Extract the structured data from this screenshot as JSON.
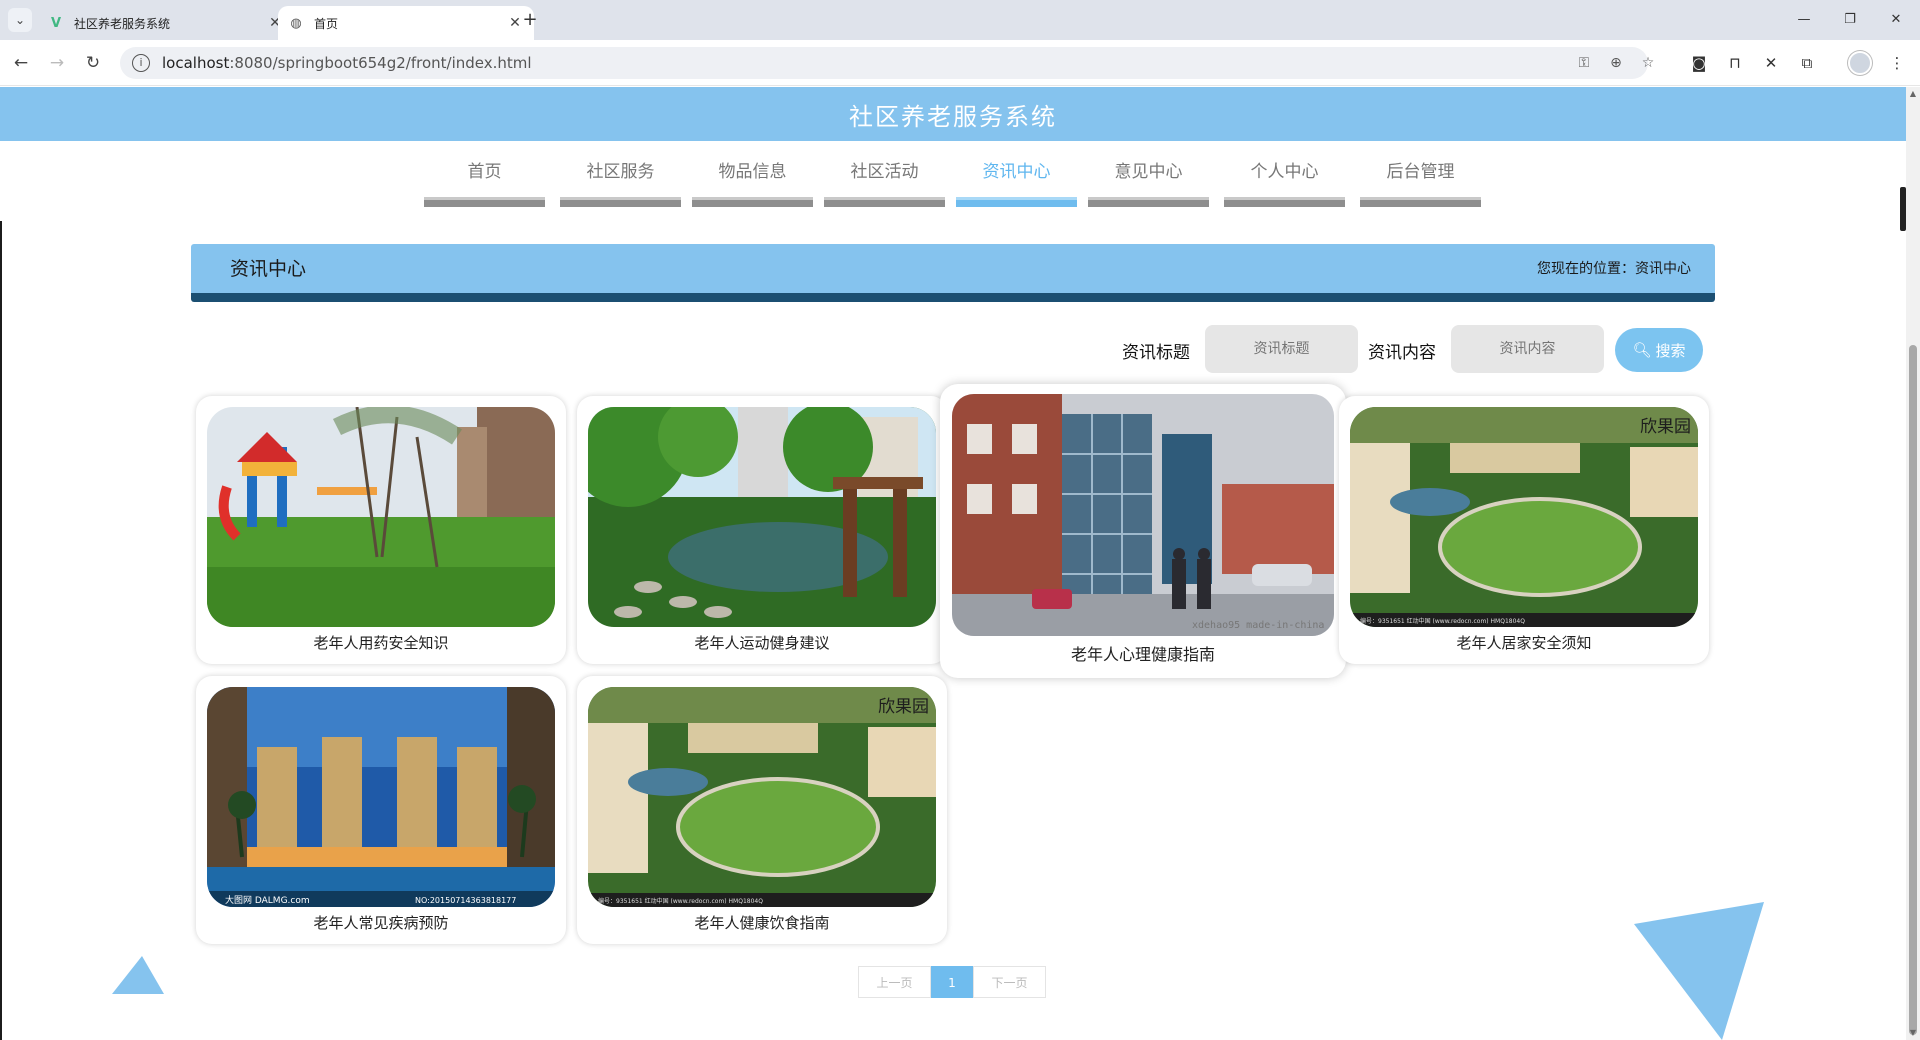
{
  "browser": {
    "tabs": [
      {
        "title": "社区养老服务系统",
        "active": false
      },
      {
        "title": "首页",
        "active": true
      }
    ],
    "url_host": "localhost",
    "url_rest": ":8080/springboot654g2/front/index.html"
  },
  "header": {
    "title": "社区养老服务系统"
  },
  "nav": {
    "items": [
      {
        "label": "首页"
      },
      {
        "label": "社区服务"
      },
      {
        "label": "物品信息"
      },
      {
        "label": "社区活动"
      },
      {
        "label": "资讯中心",
        "active": true
      },
      {
        "label": "意见中心"
      },
      {
        "label": "个人中心"
      },
      {
        "label": "后台管理"
      }
    ]
  },
  "section": {
    "title": "资讯中心",
    "breadcrumb": "您现在的位置：资讯中心"
  },
  "search": {
    "title_label": "资讯标题",
    "title_placeholder": "资讯标题",
    "content_label": "资讯内容",
    "content_placeholder": "资讯内容",
    "button": "搜索"
  },
  "articles": [
    {
      "title": "老年人用药安全知识"
    },
    {
      "title": "老年人运动健身建议"
    },
    {
      "title": "老年人心理健康指南"
    },
    {
      "title": "老年人居家安全须知"
    },
    {
      "title": "老年人常见疾病预防"
    },
    {
      "title": "老年人健康饮食指南"
    }
  ],
  "images": {
    "garden_stamp": "欣果园",
    "garden_footer": "编号：9351651   红动中国 (www.redocn.com)   HMQ1804Q",
    "hotel_brand": "大图网 DALMG.com",
    "hotel_no": "NO:20150714363818177",
    "street_watermark": "xdehao95   made-in-china"
  },
  "pagination": {
    "prev": "上一页",
    "current": "1",
    "next": "下一页"
  },
  "colors": {
    "brand": "#85c3ee",
    "banner_border": "#1b4f72",
    "active_nav": "#5fb6ef"
  }
}
